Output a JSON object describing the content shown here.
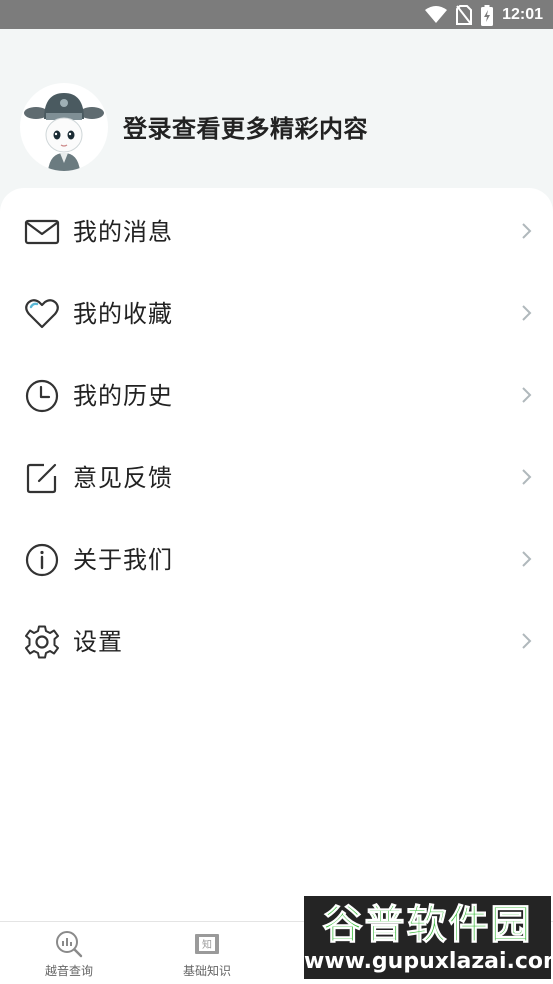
{
  "status_bar": {
    "time": "12:01",
    "icons": [
      "wifi-icon",
      "no-sim-icon",
      "battery-charging-icon"
    ]
  },
  "header": {
    "login_prompt": "登录查看更多精彩内容",
    "avatar_icon": "opera-character-avatar"
  },
  "menu": {
    "items": [
      {
        "label": "我的消息",
        "icon": "mail-icon"
      },
      {
        "label": "我的收藏",
        "icon": "heart-icon"
      },
      {
        "label": "我的历史",
        "icon": "clock-icon"
      },
      {
        "label": "意见反馈",
        "icon": "edit-icon"
      },
      {
        "label": "关于我们",
        "icon": "info-icon"
      },
      {
        "label": "设置",
        "icon": "gear-icon"
      }
    ],
    "chevron_icon": "chevron-right-icon"
  },
  "bottom_nav": {
    "tabs": [
      {
        "label": "越音查询",
        "icon": "search-chart-icon"
      },
      {
        "label": "基础知识",
        "icon": "book-icon"
      }
    ]
  },
  "watermark": {
    "logo_text": "谷普软件园",
    "url": "www.gupuxlazai.com"
  },
  "colors": {
    "status_bar": "#7c7c7c",
    "header_bg": "#f3f6f6",
    "card_bg": "#ffffff",
    "text": "#222222",
    "chevron": "#b0b8bc",
    "heart_accent": "#5ab8d6"
  }
}
